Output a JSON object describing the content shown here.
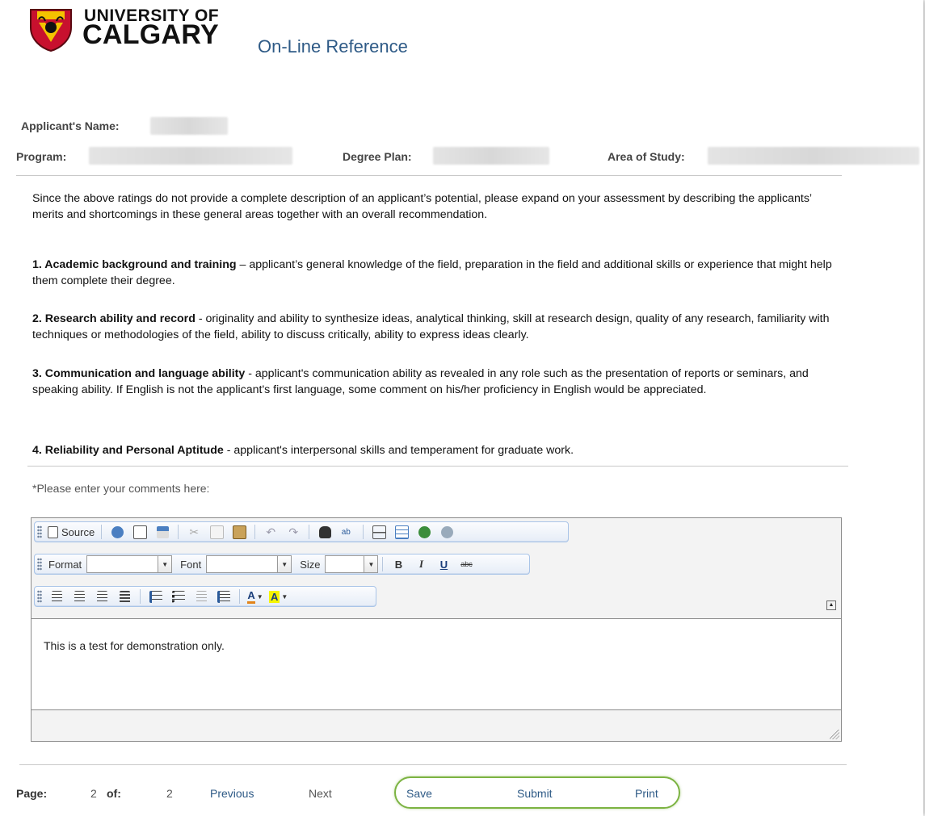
{
  "header": {
    "logo_line1": "UNIVERSITY OF",
    "logo_line2": "CALGARY",
    "app_title": "On-Line Reference"
  },
  "applicant": {
    "name_label": "Applicant's Name:",
    "program_label": "Program:",
    "degree_plan_label": "Degree Plan:",
    "area_of_study_label": "Area of Study:"
  },
  "intro": "Since the above ratings do not provide a complete description of an applicant’s potential, please expand on your assessment by describing the applicants’ merits and shortcomings in these general areas together with an overall recommendation.",
  "criteria": [
    {
      "title": "1. Academic background and training",
      "sep": " – ",
      "text": "applicant’s general knowledge of the field, preparation in the field and additional skills or experience that might help them complete their degree."
    },
    {
      "title": "2. Research ability and record",
      "sep": " - ",
      "text": "originality and ability to synthesize ideas, analytical thinking, skill at research design, quality of any research, familiarity with techniques or methodologies of the field, ability to discuss critically, ability to express ideas clearly."
    },
    {
      "title": "3. Communication and language ability",
      "sep": " - ",
      "text": "applicant's communication ability as revealed in any role such as the presentation of reports or seminars, and speaking ability. If English is not the applicant's first language, some comment on his/her proficiency in English would be appreciated."
    },
    {
      "title": "4. Reliability and Personal Aptitude",
      "sep": " - ",
      "text": "applicant's interpersonal skills and temperament for graduate work."
    }
  ],
  "comments_label": "*Please enter your comments here:",
  "editor": {
    "source_label": "Source",
    "format_label": "Format",
    "font_label": "Font",
    "size_label": "Size",
    "bold": "B",
    "italic": "I",
    "underline": "U",
    "strike": "abc",
    "content": "This is a test for demonstration only."
  },
  "footer": {
    "page_label": "Page:",
    "page_current": "2",
    "of_label": "of:",
    "page_total": "2",
    "previous": "Previous",
    "next": "Next",
    "save": "Save",
    "submit": "Submit",
    "print": "Print"
  },
  "colors": {
    "link": "#2e5a86",
    "highlight_oval": "#7cb342",
    "toolbar_border": "#a9c4e8"
  }
}
